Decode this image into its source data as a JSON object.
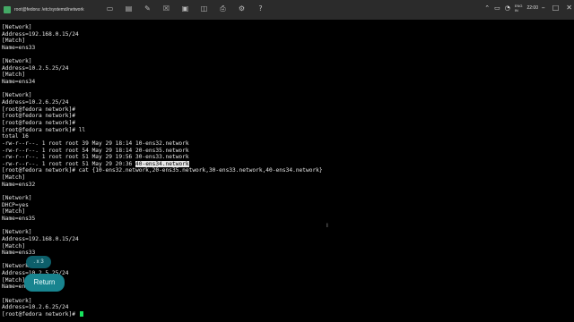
{
  "window": {
    "title": "root@fedora: /etc/systemd/network"
  },
  "toolbar_icons": [
    "terminal-icon",
    "folder-icon",
    "edit-icon",
    "close-box-icon",
    "image-icon",
    "view-icon",
    "print-icon",
    "settings-icon",
    "help-icon"
  ],
  "tray": {
    "lang_top": "ENG",
    "lang_bottom": "IN",
    "time": "22:00"
  },
  "terminal": {
    "lines": [
      "[Network]",
      "Address=192.168.0.15/24",
      "[Match]",
      "Name=ens33",
      "",
      "[Network]",
      "Address=10.2.5.25/24",
      "[Match]",
      "Name=ens34",
      "",
      "[Network]",
      "Address=10.2.6.25/24",
      "[root@fedora network]#",
      "[root@fedora network]#",
      "[root@fedora network]#",
      "[root@fedora network]# ll",
      "total 16",
      "-rw-r--r--. 1 root root 39 May 29 18:14 10-ens32.network",
      "-rw-r--r--. 1 root root 54 May 29 18:14 20-ens35.network",
      "-rw-r--r--. 1 root root 51 May 29 19:56 30-ens33.network",
      "-rw-r--r--. 1 root root 51 May 29 20:36 ",
      "[root@fedora network]# cat {10-ens32.network,20-ens35.network,30-ens33.network,40-ens34.network}",
      "[Match]",
      "Name=ens32",
      "",
      "[Network]",
      "DHCP=yes",
      "[Match]",
      "Name=ens35",
      "",
      "[Network]",
      "Address=192.168.0.15/24",
      "[Match]",
      "Name=ens33",
      "",
      "[Network]",
      "Address=10.2.5.25/24",
      "[Match]",
      "Name=ens34",
      "",
      "[Network]",
      "Address=10.2.6.25/24",
      "[root@fedora network]# "
    ],
    "highlighted_text": "40-ens34.network"
  },
  "overlay": {
    "key_count": ". x 3",
    "key_label": "Return"
  }
}
